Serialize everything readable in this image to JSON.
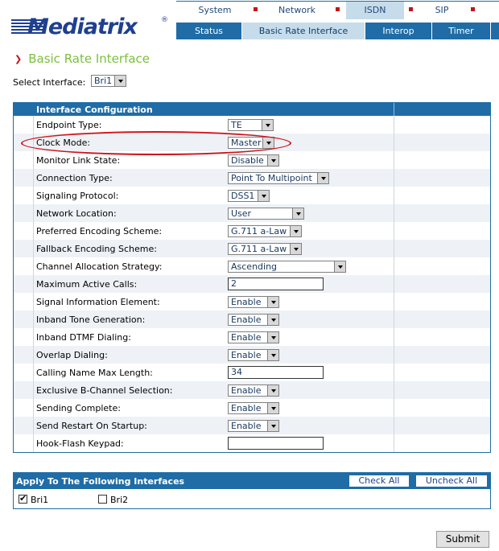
{
  "logo": {
    "text": "Mediatrix",
    "reg": "®"
  },
  "nav_primary": [
    {
      "label": "System",
      "active": false
    },
    {
      "label": "Network",
      "active": false
    },
    {
      "label": "ISDN",
      "active": true
    },
    {
      "label": "SIP",
      "active": false
    }
  ],
  "nav_secondary": [
    {
      "label": "Status",
      "active": false
    },
    {
      "label": "Basic Rate Interface",
      "active": true
    },
    {
      "label": "Interop",
      "active": false
    },
    {
      "label": "Timer",
      "active": false
    }
  ],
  "page": {
    "title": "Basic Rate Interface"
  },
  "select_interface": {
    "label": "Select Interface:",
    "value": "Bri1"
  },
  "config": {
    "title": "Interface Configuration",
    "rows": [
      {
        "label": "Endpoint Type:",
        "type": "select",
        "value": "TE"
      },
      {
        "label": "Clock Mode:",
        "type": "select",
        "value": "Master"
      },
      {
        "label": "Monitor Link State:",
        "type": "select",
        "value": "Disable"
      },
      {
        "label": "Connection Type:",
        "type": "select",
        "value": "Point To Multipoint"
      },
      {
        "label": "Signaling Protocol:",
        "type": "select",
        "value": "DSS1"
      },
      {
        "label": "Network Location:",
        "type": "select",
        "value": "User"
      },
      {
        "label": "Preferred Encoding Scheme:",
        "type": "select",
        "value": "G.711 a-Law"
      },
      {
        "label": "Fallback Encoding Scheme:",
        "type": "select",
        "value": "G.711 a-Law"
      },
      {
        "label": "Channel Allocation Strategy:",
        "type": "select",
        "value": "Ascending"
      },
      {
        "label": "Maximum Active Calls:",
        "type": "text",
        "value": "2"
      },
      {
        "label": "Signal Information Element:",
        "type": "select",
        "value": "Enable"
      },
      {
        "label": "Inband Tone Generation:",
        "type": "select",
        "value": "Enable"
      },
      {
        "label": "Inband DTMF Dialing:",
        "type": "select",
        "value": "Enable"
      },
      {
        "label": "Overlap Dialing:",
        "type": "select",
        "value": "Enable"
      },
      {
        "label": "Calling Name Max Length:",
        "type": "text",
        "value": "34"
      },
      {
        "label": "Exclusive B-Channel Selection:",
        "type": "select",
        "value": "Enable"
      },
      {
        "label": "Sending Complete:",
        "type": "select",
        "value": "Enable"
      },
      {
        "label": "Send Restart On Startup:",
        "type": "select",
        "value": "Enable"
      },
      {
        "label": "Hook-Flash Keypad:",
        "type": "text",
        "value": ""
      }
    ]
  },
  "apply": {
    "title": "Apply To The Following Interfaces",
    "check_all": "Check All",
    "uncheck_all": "Uncheck All",
    "interfaces": [
      {
        "label": "Bri1",
        "checked": true
      },
      {
        "label": "Bri2",
        "checked": false
      }
    ]
  },
  "submit_label": "Submit",
  "colors": {
    "nav_blue": "#1f6ca6",
    "title_green": "#7bbf3a",
    "highlight_red": "#d0141c",
    "active_tab": "#c6dcea"
  }
}
